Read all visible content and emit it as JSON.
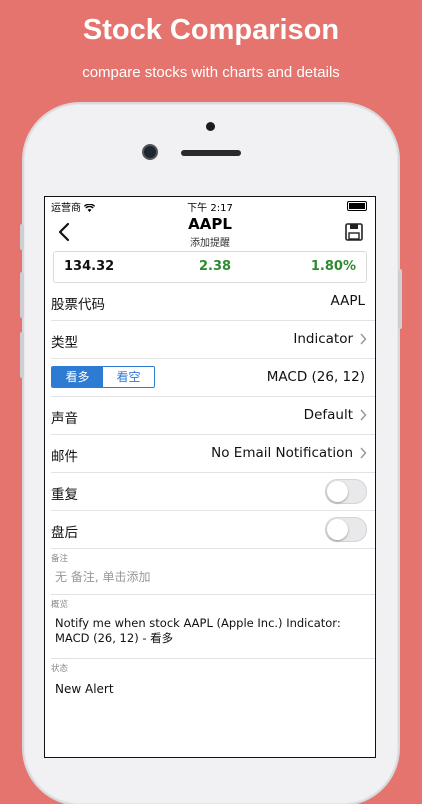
{
  "hero": {
    "title": "Stock Comparison",
    "subtitle": "compare stocks with charts and details",
    "background": "#E5746E"
  },
  "status_bar": {
    "carrier": "运营商",
    "time": "下午 2:17",
    "wifi_icon": "wifi-icon",
    "battery_icon": "battery-icon"
  },
  "nav": {
    "title": "AAPL",
    "subtitle": "添加提醒",
    "back_icon": "chevron-left-icon",
    "save_icon": "save-icon"
  },
  "quote": {
    "price": "134.32",
    "change": "2.38",
    "percent": "1.80%",
    "up_color": "#2E8B2E"
  },
  "form": {
    "symbol": {
      "label": "股票代码",
      "value": "AAPL"
    },
    "type": {
      "label": "类型",
      "value": "Indicator"
    },
    "direction": {
      "options": [
        "看多",
        "看空"
      ],
      "selected": "看多",
      "value": "MACD (26, 12)",
      "accent": "#2E7BD4"
    },
    "sound": {
      "label": "声音",
      "value": "Default"
    },
    "email": {
      "label": "邮件",
      "value": "No Email Notification"
    },
    "repeat": {
      "label": "重复",
      "on": false
    },
    "after_hours": {
      "label": "盘后",
      "on": false
    },
    "note": {
      "caption": "备注",
      "placeholder": "无 备注, 单击添加"
    },
    "overview": {
      "caption": "概览",
      "text": "Notify me when stock AAPL (Apple Inc.) Indicator: MACD (26, 12) - 看多"
    },
    "status": {
      "caption": "状态",
      "text": "New Alert"
    }
  }
}
